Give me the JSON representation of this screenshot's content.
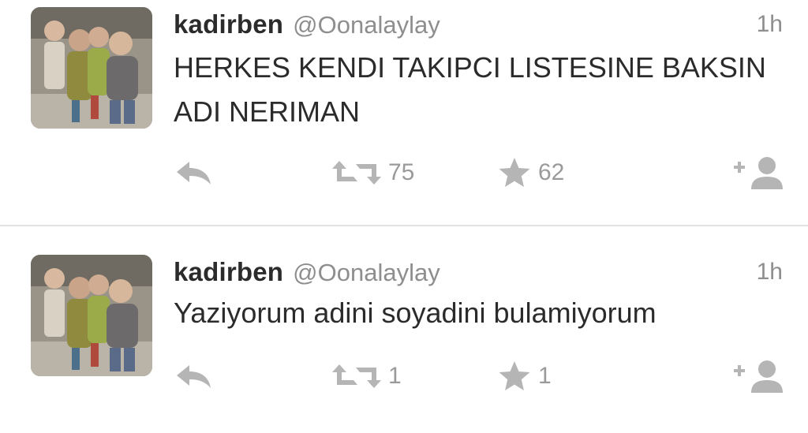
{
  "tweets": [
    {
      "name": "kadirben",
      "handle": "@Oonalaylay",
      "time": "1h",
      "text": "HERKES KENDI TAKIPCI LISTESINE BAKSIN ADI NERIMAN",
      "retweets": "75",
      "favorites": "62",
      "icons": [
        "reply-icon",
        "retweet-icon",
        "star-icon",
        "follow-icon"
      ]
    },
    {
      "name": "kadirben",
      "handle": "@Oonalaylay",
      "time": "1h",
      "text": "Yaziyorum adini soyadini bulamiyorum",
      "retweets": "1",
      "favorites": "1",
      "icons": [
        "reply-icon",
        "retweet-icon",
        "star-icon",
        "follow-icon"
      ]
    }
  ],
  "colors": {
    "text": "#2b2b2b",
    "muted": "#8e8e8e",
    "icon": "#b5b5b5",
    "divider": "#e3e3e3"
  }
}
